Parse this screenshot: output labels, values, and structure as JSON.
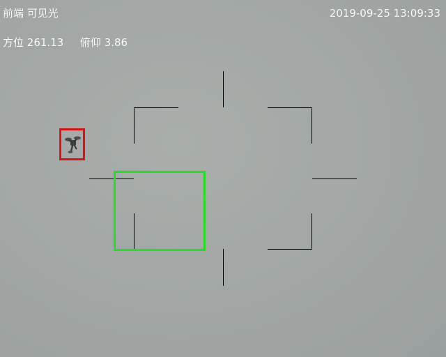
{
  "hud": {
    "camera_mode": "前端  可见光",
    "timestamp": "2019-09-25 13:09:33",
    "azimuth_label": "方位",
    "azimuth_value": "261.13",
    "elevation_label": "俯仰",
    "elevation_value": "3.86"
  },
  "overlay": {
    "tracking_box_color": "#22e01f",
    "target_box_color": "#e01010",
    "reticle_color": "#000000",
    "target_icon": "drone-icon"
  }
}
